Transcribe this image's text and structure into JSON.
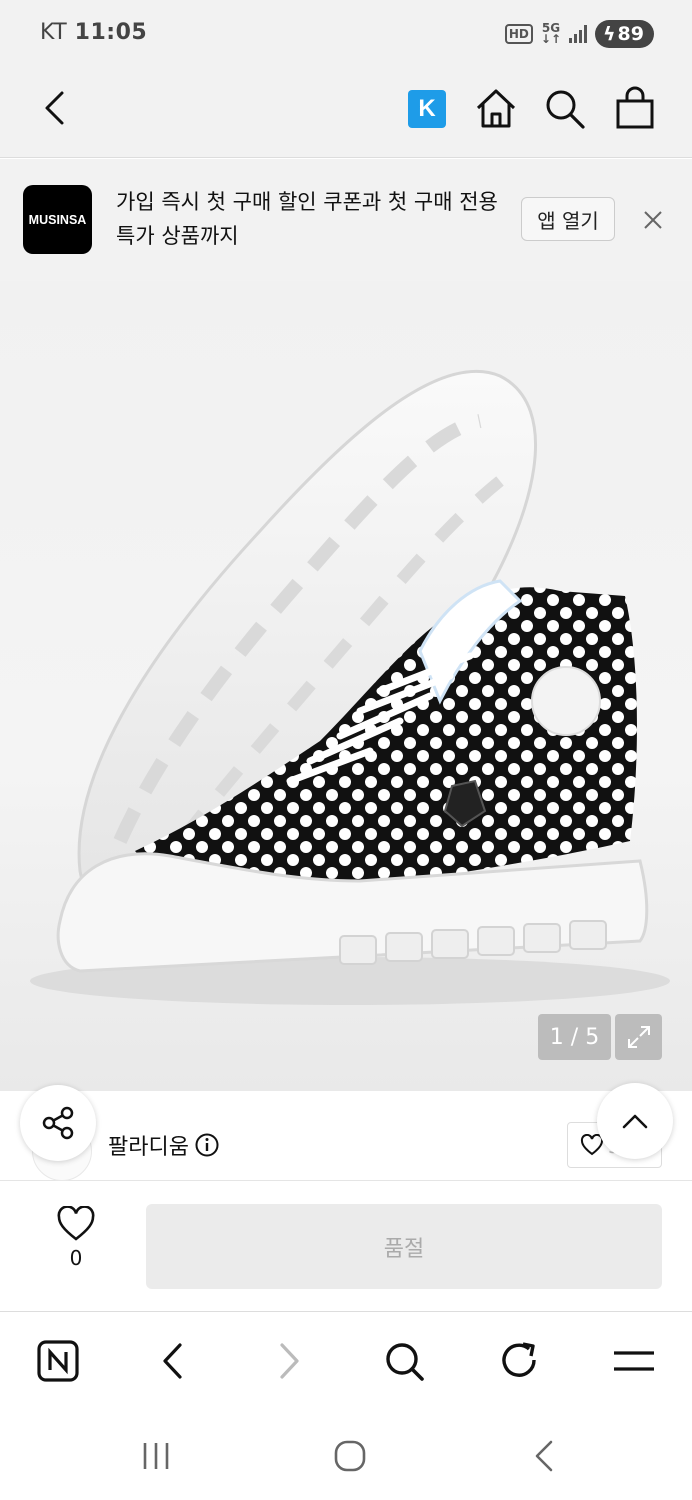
{
  "status_bar": {
    "carrier": "KT",
    "time": "11:05",
    "hd": "HD",
    "network": "5G",
    "battery": "89"
  },
  "app_bar": {
    "k_label": "K",
    "icons": [
      "back-icon",
      "k-icon",
      "home-icon",
      "search-icon",
      "shopping-bag-icon"
    ]
  },
  "banner": {
    "logo": "MUSINSA",
    "text": "가입 즉시 첫 구매 할인 쿠폰과 첫 구매 전용 특가 상품까지",
    "open_label": "앱 열기"
  },
  "gallery": {
    "counter": "1 / 5"
  },
  "product": {
    "brand": "팔라디움",
    "favorite_count": "3천"
  },
  "purchase": {
    "like_count": "0",
    "button_label": "품절"
  },
  "colors": {
    "accent_k": "#1e9ce8",
    "soldout_bg": "#ebebeb",
    "page_bg": "#f2f2f2"
  }
}
